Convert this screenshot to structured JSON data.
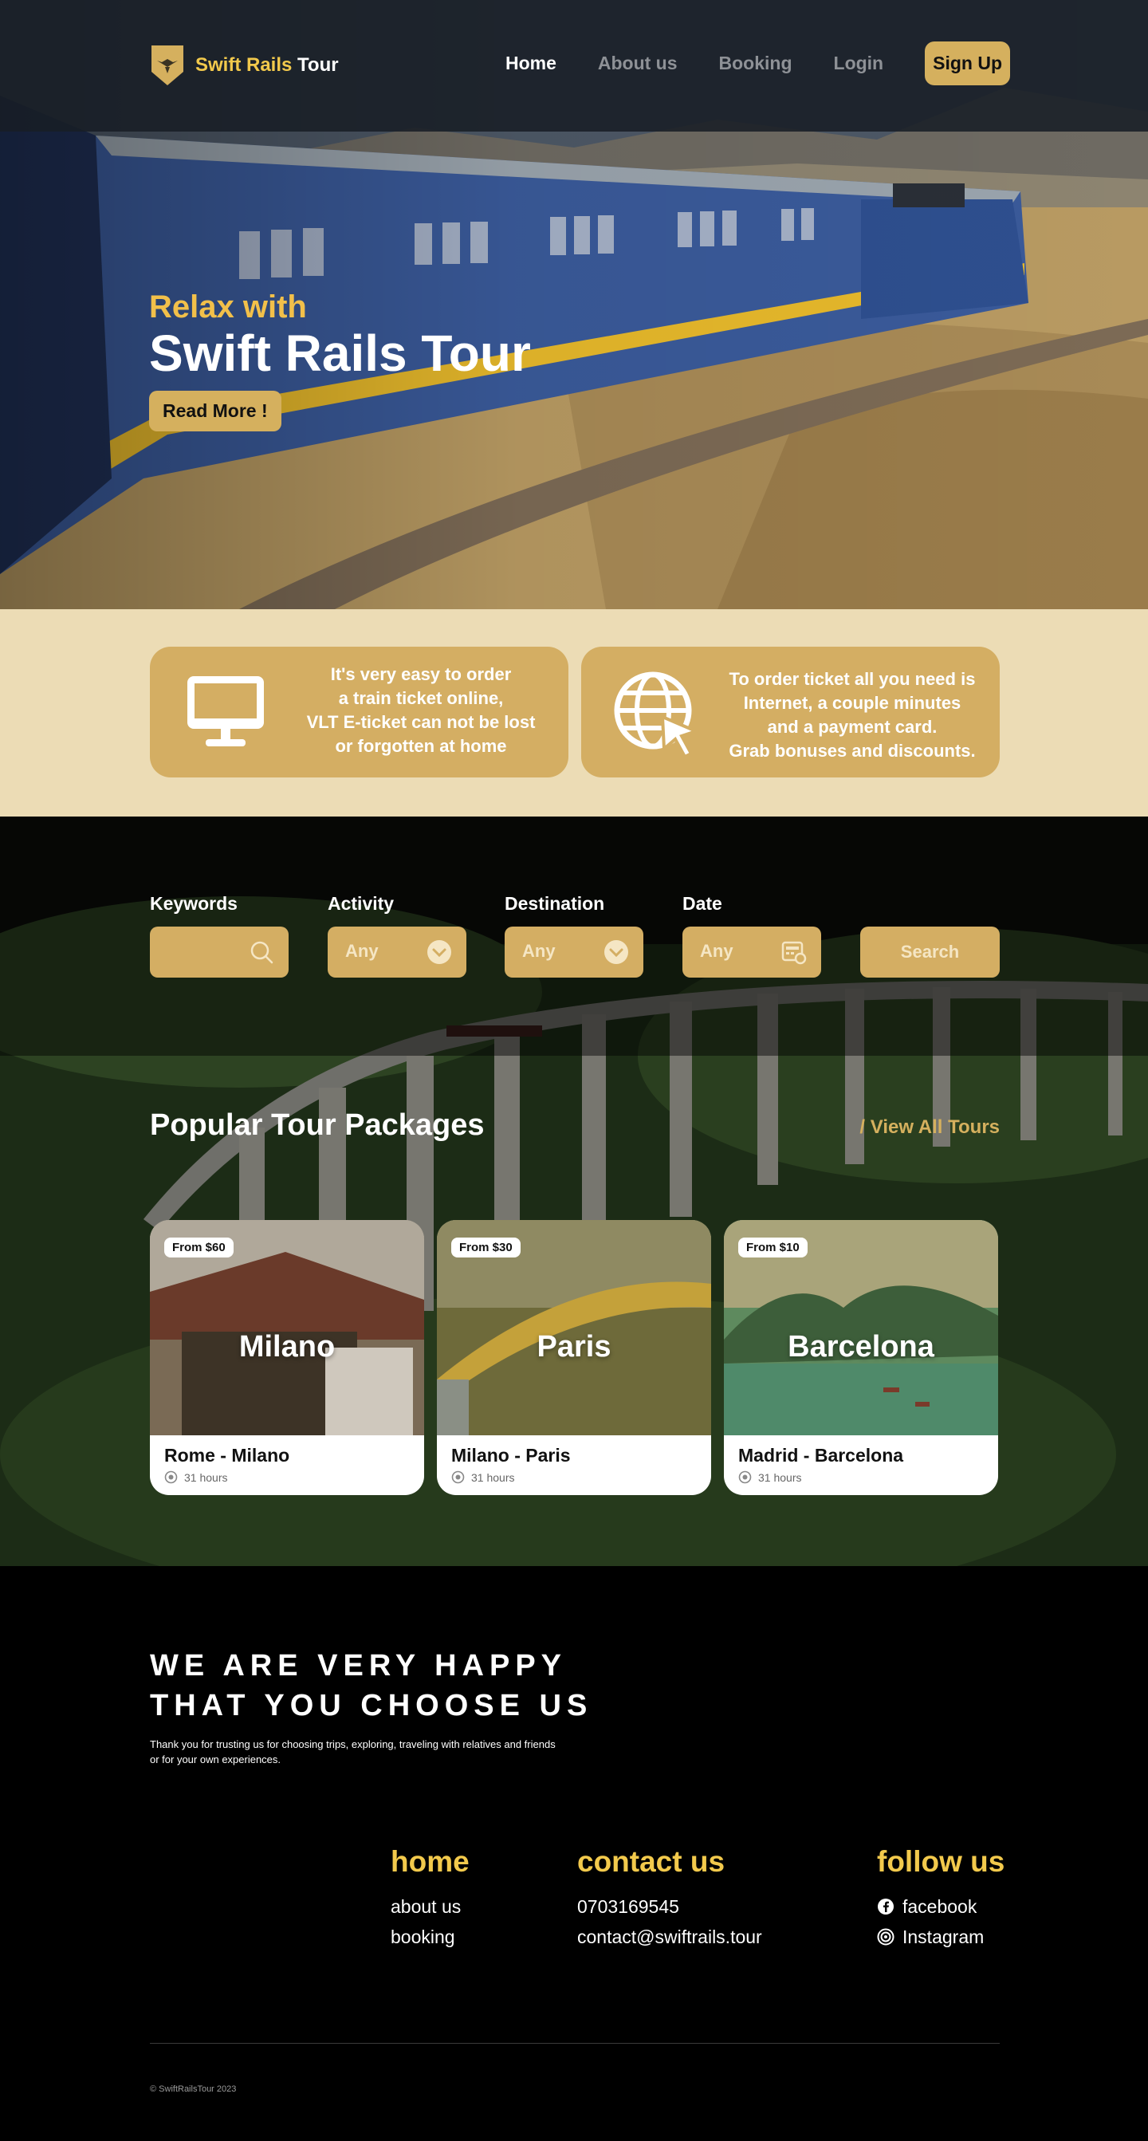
{
  "brand": {
    "name_part1": "Swift Rails",
    "name_part2": " Tour"
  },
  "nav": {
    "items": [
      {
        "label": "Home",
        "active": true
      },
      {
        "label": "About us",
        "active": false
      },
      {
        "label": "Booking",
        "active": false
      },
      {
        "label": "Login",
        "active": false
      }
    ],
    "signup_label": "Sign Up"
  },
  "hero": {
    "kicker": "Relax with",
    "title": "Swift Rails Tour",
    "button": "Read More !"
  },
  "info": {
    "card1": {
      "icon": "monitor-icon",
      "lines": [
        "It's very easy to order",
        "a train ticket online,",
        "VLT E-ticket can not be lost",
        "or forgotten at home"
      ]
    },
    "card2": {
      "icon": "globe-cursor-icon",
      "lines": [
        "To order ticket all you need is",
        "Internet, a couple minutes",
        "and a payment card.",
        "Grab bonuses and discounts."
      ]
    }
  },
  "filters": {
    "keywords": {
      "label": "Keywords",
      "placeholder": "",
      "icon": "search-icon"
    },
    "activity": {
      "label": "Activity",
      "value": "Any",
      "icon": "chevron-down-icon"
    },
    "destination": {
      "label": "Destination",
      "value": "Any",
      "icon": "chevron-down-icon"
    },
    "date": {
      "label": "Date",
      "value": "Any",
      "icon": "calendar-icon"
    },
    "search_label": "Search"
  },
  "tours": {
    "title": "Popular Tour Packages",
    "view_all": "/ View All Tours",
    "items": [
      {
        "price": "From $60",
        "city": "Milano",
        "route": "Rome - Milano",
        "duration": "31 hours"
      },
      {
        "price": "From $30",
        "city": "Paris",
        "route": "Milano - Paris",
        "duration": "31 hours"
      },
      {
        "price": "From $10",
        "city": "Barcelona",
        "route": "Madrid - Barcelona",
        "duration": "31 hours"
      }
    ]
  },
  "footer": {
    "happy_line1": "WE ARE VERY HAPPY",
    "happy_line2": "THAT YOU CHOOSE US",
    "happy_sub": "Thank you for trusting us for choosing trips, exploring, traveling with relatives and friends or for your own experiences.",
    "home": {
      "heading": "home",
      "links": [
        "about us",
        "booking"
      ]
    },
    "contact": {
      "heading": "contact us",
      "phone": "0703169545",
      "email": "contact@swiftrails.tour"
    },
    "follow": {
      "heading": "follow us",
      "links": [
        "facebook",
        "Instagram"
      ]
    },
    "copyright": "© SwiftRailsTour 2023"
  },
  "colors": {
    "gold": "#d5b05e",
    "gold_text": "#f2c94c",
    "cream": "#ecdcb5",
    "nav_bg": "#181e26"
  }
}
